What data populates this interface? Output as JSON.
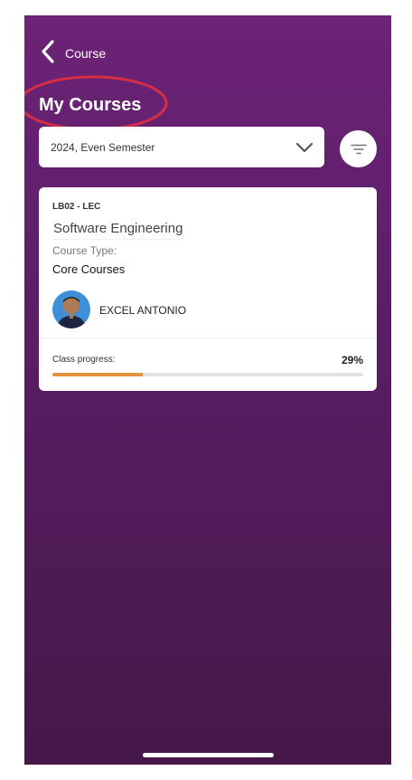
{
  "header": {
    "back_label": "Course",
    "page_title": "My Courses"
  },
  "filters": {
    "semester_selected": "2024, Even Semester"
  },
  "course_card": {
    "code": "LB02 - LEC",
    "name": "Software Engineering",
    "type_label": "Course Type:",
    "type_value": "Core Courses",
    "lecturer": "EXCEL ANTONIO",
    "progress_label": "Class progress:",
    "progress_text": "29%",
    "progress_percent": 29
  },
  "colors": {
    "background_top": "#6d2377",
    "background_bottom": "#451848",
    "annotation_ring": "#d62e45",
    "progress_fill": "#e3913b"
  },
  "icons": {
    "back": "chevron-left-icon",
    "dropdown": "chevron-down-icon",
    "filter": "filter-icon"
  }
}
